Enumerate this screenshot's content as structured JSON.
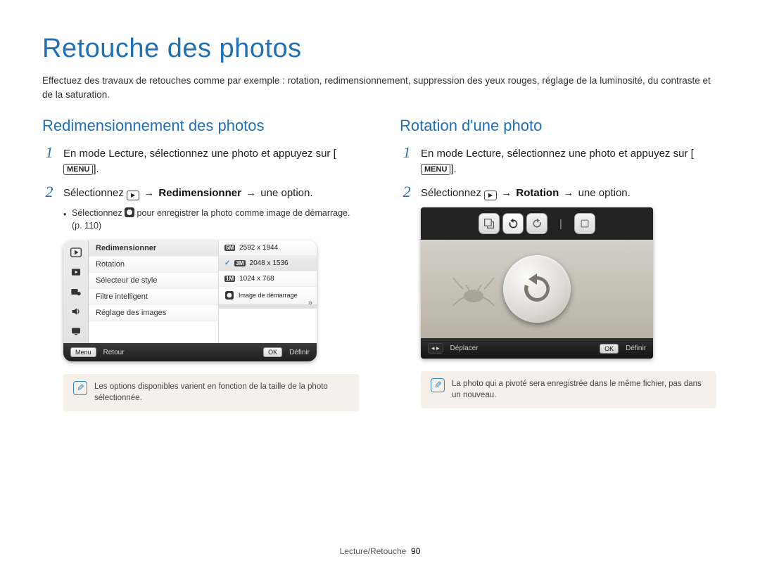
{
  "title": "Retouche des photos",
  "intro": "Effectuez des travaux de retouches comme par exemple : rotation, redimensionnement, suppression des yeux rouges, réglage de la luminosité, du contraste et de la saturation.",
  "left": {
    "heading": "Redimensionnement des photos",
    "step1_a": "En mode Lecture, sélectionnez une photo et appuyez sur [",
    "menu_label": "MENU",
    "step1_b": "].",
    "step2_a": "Sélectionnez ",
    "arrow": "→",
    "step2_bold": "Redimensionner",
    "step2_b": " une option.",
    "bullet_a": "Sélectionnez ",
    "bullet_b": " pour enregistrer la photo comme image de démarrage. (p. 110)",
    "menu": {
      "items": [
        "Redimensionner",
        "Rotation",
        "Sélecteur de style",
        "Filtre intelligent",
        "Réglage des images"
      ],
      "vals": [
        {
          "sz": "5M",
          "txt": "2592 x 1944"
        },
        {
          "sz": "3M",
          "txt": "2048 x 1536",
          "sel": true
        },
        {
          "sz": "1M",
          "txt": "1024 x 768"
        },
        {
          "sz": "",
          "txt": "Image de démarrage",
          "startup": true
        }
      ],
      "footer_back_btn": "Menu",
      "footer_back": "Retour",
      "footer_ok_btn": "OK",
      "footer_ok": "Définir"
    },
    "note": "Les options disponibles varient en fonction de la taille de la photo sélectionnée."
  },
  "right": {
    "heading": "Rotation d'une photo",
    "step1_a": "En mode Lecture, sélectionnez une photo et appuyez sur [",
    "menu_label": "MENU",
    "step1_b": "].",
    "step2_a": "Sélectionnez ",
    "arrow": "→",
    "step2_bold": "Rotation",
    "step2_b": " une option.",
    "screen": {
      "footer_move_btn": "◂ ▸",
      "footer_move": "Déplacer",
      "footer_ok_btn": "OK",
      "footer_ok": "Définir"
    },
    "note": "La photo qui a pivoté sera enregistrée dans le même fichier, pas dans un nouveau."
  },
  "footer": {
    "section": "Lecture/Retouche",
    "page": "90"
  }
}
